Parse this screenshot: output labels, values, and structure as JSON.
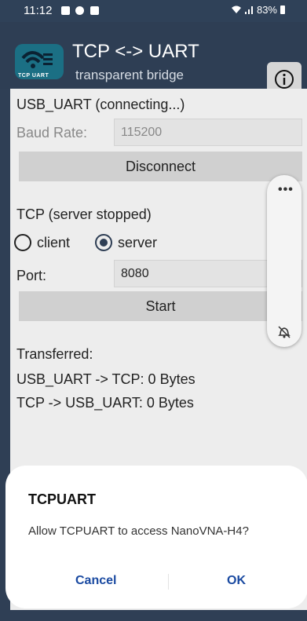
{
  "status_bar": {
    "time": "11:12",
    "battery": "83%",
    "icons": [
      "image-icon",
      "account-icon",
      "notification-icon",
      "wifi-icon",
      "signal-icon",
      "battery-icon"
    ]
  },
  "header": {
    "title": "TCP <-> UART",
    "subtitle": "transparent bridge",
    "logo_text": "TCP UART",
    "info_icon": "info-icon"
  },
  "usb_uart": {
    "status_label": "USB_UART (connecting...)",
    "baud_label": "Baud Rate:",
    "baud_value": "115200",
    "disconnect_label": "Disconnect"
  },
  "tcp": {
    "status_label": "TCP (server stopped)",
    "mode_options": [
      {
        "label": "client",
        "selected": false
      },
      {
        "label": "server",
        "selected": true
      }
    ],
    "port_label": "Port:",
    "port_value": "8080",
    "start_label": "Start"
  },
  "transfer": {
    "heading": "Transferred:",
    "uart_to_tcp": "USB_UART -> TCP:  0 Bytes",
    "tcp_to_uart": "TCP -> USB_UART:  0 Bytes"
  },
  "overlay": {
    "more_icon": "more-dots-icon",
    "mute_icon": "mute-icon"
  },
  "dialog": {
    "title": "TCPUART",
    "message": "Allow TCPUART to access NanoVNA-H4?",
    "cancel_label": "Cancel",
    "ok_label": "OK"
  },
  "colors": {
    "header_bg": "#2e3e54",
    "content_bg": "#ededed",
    "button_bg": "#d0d0d0",
    "dialog_accent": "#1a4aa1"
  }
}
